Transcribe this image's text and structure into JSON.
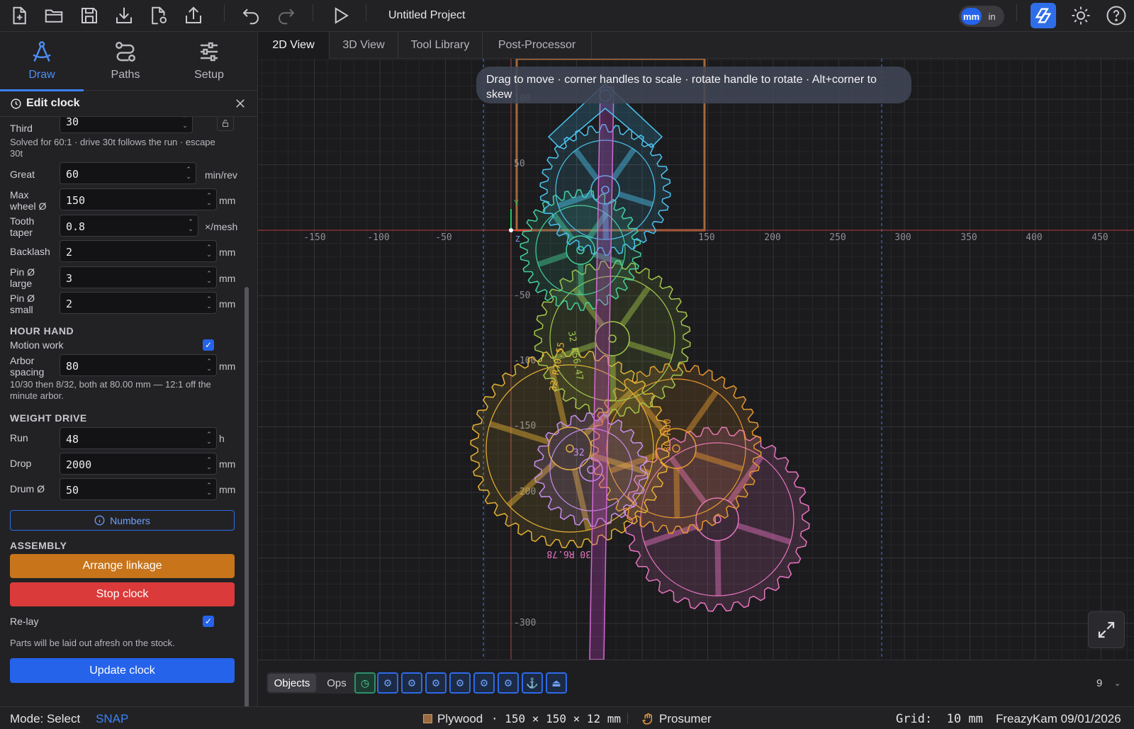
{
  "project": {
    "title": "Untitled Project"
  },
  "units": {
    "mm": "mm",
    "in": "in"
  },
  "modes": [
    {
      "label": "Draw"
    },
    {
      "label": "Paths"
    },
    {
      "label": "Setup"
    }
  ],
  "panel": {
    "title": "Edit clock",
    "fields": {
      "third": {
        "label": "Third",
        "value": "30"
      },
      "solve_note": "Solved for 60:1 · drive 30t follows the run · escape 30t",
      "great": {
        "label": "Great",
        "value": "60",
        "unit": "min/rev"
      },
      "max_wheel": {
        "label": "Max wheel Ø",
        "value": "150",
        "unit": "mm"
      },
      "tooth_taper": {
        "label": "Tooth taper",
        "value": "0.8",
        "unit": "×/mesh"
      },
      "backlash": {
        "label": "Backlash",
        "value": "2",
        "unit": "mm"
      },
      "pin_large": {
        "label": "Pin Ø large",
        "value": "3",
        "unit": "mm"
      },
      "pin_small": {
        "label": "Pin Ø small",
        "value": "2",
        "unit": "mm"
      }
    },
    "hour_hand": {
      "heading": "HOUR HAND",
      "motion_work": {
        "label": "Motion work",
        "checked": true
      },
      "arbor_spacing": {
        "label": "Arbor spacing",
        "value": "80",
        "unit": "mm"
      },
      "note": "10/30 then 8/32, both at 80.00 mm — 12:1 off the minute arbor."
    },
    "weight_drive": {
      "heading": "WEIGHT DRIVE",
      "run": {
        "label": "Run",
        "value": "48",
        "unit": "h"
      },
      "drop": {
        "label": "Drop",
        "value": "2000",
        "unit": "mm"
      },
      "drum": {
        "label": "Drum Ø",
        "value": "50",
        "unit": "mm"
      }
    },
    "numbers_button": "Numbers",
    "assembly": {
      "heading": "ASSEMBLY",
      "arrange_button": "Arrange linkage",
      "stop_button": "Stop clock",
      "relay": {
        "label": "Re-lay",
        "checked": true
      },
      "relay_note": "Parts will be laid out afresh on the stock.",
      "update_button": "Update clock"
    }
  },
  "view_tabs": [
    "2D View",
    "3D View",
    "Tool Library",
    "Post-Processor"
  ],
  "active_view": "2D View",
  "canvas": {
    "hint": "Drag to move · corner handles to scale · rotate handle to rotate · Alt+corner to skew",
    "x_ticks": [
      "-150",
      "-100",
      "-50",
      "150",
      "200",
      "250",
      "300",
      "350",
      "400",
      "450"
    ],
    "y_ticks": [
      "100",
      "50",
      "-50",
      "-100",
      "-150",
      "-200",
      "-300"
    ],
    "axis_labels": {
      "y": "Y",
      "z": "Z"
    },
    "gear_labels": [
      "32 R56.47",
      "32 R70.55",
      "30 R60",
      "30 R6.78",
      "32"
    ]
  },
  "object_bar": {
    "tabs": [
      "Objects",
      "Ops"
    ],
    "active_tab": "Objects",
    "chips": [
      "clock-icon",
      "gear-icon",
      "gear-icon",
      "gear-icon",
      "gear-icon",
      "gear-icon",
      "gear-icon",
      "anchor-icon",
      "weight-icon"
    ],
    "count": "9"
  },
  "status": {
    "mode": "Mode: Select",
    "snap": "SNAP",
    "material": "Plywood",
    "stock": "· 150 × 150 × 12 mm",
    "machine": "Prosumer",
    "grid": "Grid:  10 mm",
    "credit": "FreazyKam 09/01/2026"
  },
  "colors": {
    "accent": "#2563eb",
    "arrange": "#c8741a",
    "stop": "#db3a3a",
    "update": "#2563eb"
  }
}
